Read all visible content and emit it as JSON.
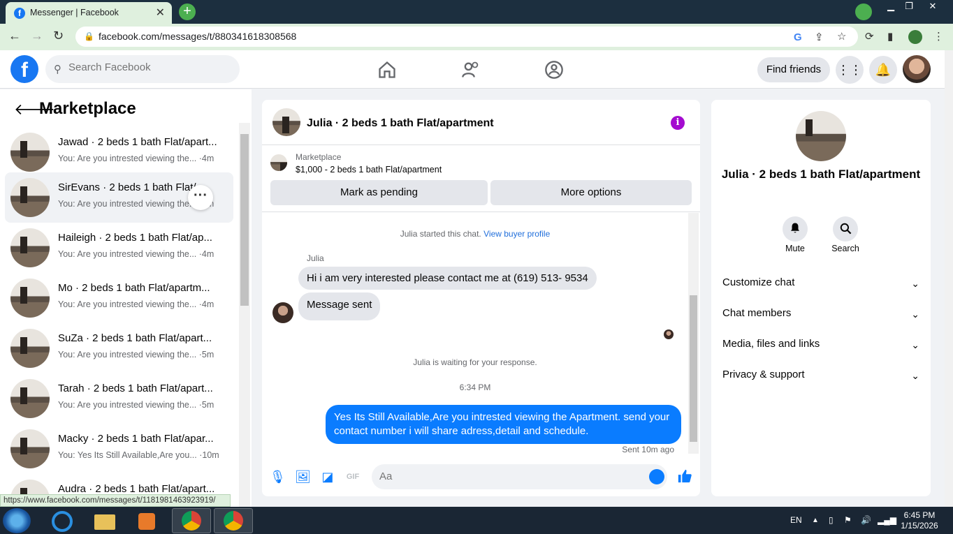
{
  "browser": {
    "tab_title": "Messenger | Facebook",
    "tab_favicon": "f",
    "url": "facebook.com/messages/t/880341618308568",
    "status_url": "https://www.facebook.com/messages/t/1181981463923919/"
  },
  "header": {
    "logo": "f",
    "search_placeholder": "Search Facebook",
    "find_friends": "Find friends"
  },
  "left": {
    "title": "Marketplace",
    "conversations": [
      {
        "name": "Jawad · 2 beds 1 bath Flat/apart...",
        "preview": "You: Are you intrested viewing the... ·4m"
      },
      {
        "name": "SirEvans · 2 beds 1 bath Flat/...",
        "preview": "You: Are you intrested viewing the... ·4m"
      },
      {
        "name": "Haileigh · 2 beds 1 bath Flat/ap...",
        "preview": "You: Are you intrested viewing the... ·4m"
      },
      {
        "name": "Mo · 2 beds 1 bath Flat/apartm...",
        "preview": "You: Are you intrested viewing the... ·4m"
      },
      {
        "name": "SuZa · 2 beds 1 bath Flat/apart...",
        "preview": "You: Are you intrested viewing the... ·5m"
      },
      {
        "name": "Tarah · 2 beds 1 bath Flat/apart...",
        "preview": "You: Are you intrested viewing the... ·5m"
      },
      {
        "name": "Macky · 2 beds 1 bath Flat/apar...",
        "preview": "You: Yes Its Still Available,Are you... ·10m"
      },
      {
        "name": "Audra · 2 beds 1 bath Flat/apart...",
        "preview": ""
      }
    ]
  },
  "chat": {
    "title": "Julia · 2 beds 1 bath Flat/apartment",
    "listing_label": "Marketplace",
    "listing_price": "$1,000 - 2 beds 1 bath Flat/apartment",
    "mark_pending": "Mark as pending",
    "more_options": "More options",
    "started_note": "Julia started this chat.",
    "view_profile": "View buyer profile",
    "sender_name": "Julia",
    "message_1": "Hi i am very interested please contact me at (619) 513- 9534",
    "message_2": "Message sent",
    "waiting_note": "Julia is waiting for your response.",
    "time": "6:34 PM",
    "outgoing": "Yes Its Still Available,Are you intrested viewing the Apartment. send your contact number i will share adress,detail and schedule.",
    "sent_status": "Sent 10m ago",
    "composer_placeholder": "Aa"
  },
  "right": {
    "name": "Julia · 2 beds 1 bath Flat/apartment",
    "mute": "Mute",
    "search": "Search",
    "sections": [
      "Customize chat",
      "Chat members",
      "Media, files and links",
      "Privacy & support"
    ]
  },
  "taskbar": {
    "lang": "EN",
    "time": "6:45 PM",
    "date": "1/15/2026"
  },
  "colors": {
    "fb_blue": "#1877f2",
    "messenger_blue": "#0a7cff",
    "info_purple": "#a40bd0"
  }
}
